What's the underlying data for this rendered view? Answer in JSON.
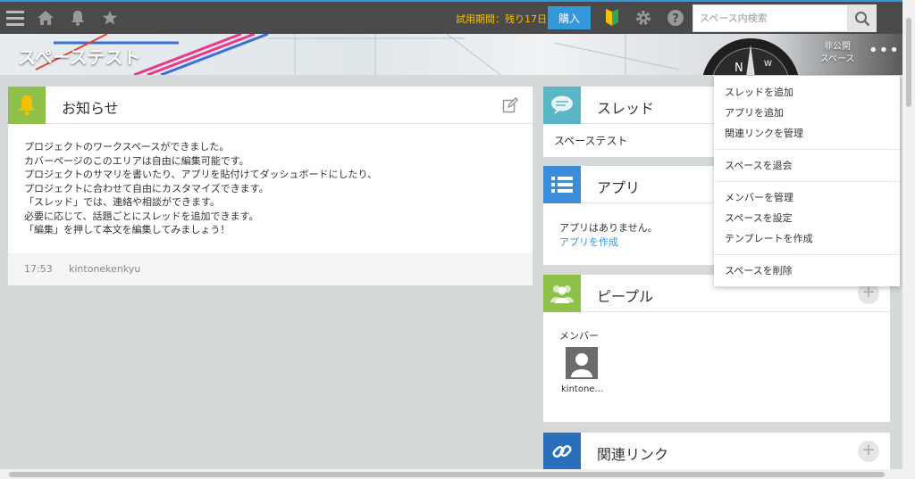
{
  "topbar": {
    "menu_icon": "hamburger-icon",
    "home_icon": "home-icon",
    "bell_icon": "bell-icon",
    "star_icon": "star-icon",
    "trial_text": "試用期間：残り17日",
    "buy_label": "購入",
    "beginner_icon": "beginner-mark-icon",
    "settings_icon": "gear-icon",
    "help_icon": "help-icon",
    "search_placeholder": "スペース内検索",
    "accent": "#3498db"
  },
  "cover": {
    "title": "スペーステスト",
    "public_line1": "非公開",
    "public_line2": "スペース",
    "more_label": "•••"
  },
  "notice": {
    "title": "お知らせ",
    "lines": [
      "プロジェクトのワークスペースができました。",
      "カバーページのこのエリアは自由に編集可能です。",
      "プロジェクトのサマリを書いたり、アプリを貼付けてダッシュボードにしたり、",
      "プロジェクトに合わせて自由にカスタマイズできます。",
      "「スレッド」では、連絡や相談ができます。",
      "必要に応じて、話題ごとにスレッドを追加できます。",
      "「編集」を押して本文を編集してみましょう！"
    ],
    "time": "17:53",
    "user": "kintonekenkyu"
  },
  "thread": {
    "title": "スレッド",
    "item": "スペーステスト"
  },
  "apps": {
    "title": "アプリ",
    "empty": "アプリはありません。",
    "create": "アプリを作成"
  },
  "people": {
    "title": "ピープル",
    "section": "メンバー",
    "member_name": "kintone…"
  },
  "links": {
    "title": "関連リンク"
  },
  "dropdown": {
    "items": [
      "スレッドを追加",
      "アプリを追加",
      "関連リンクを管理",
      "スペースを退会",
      "メンバーを管理",
      "スペースを設定",
      "テンプレートを作成",
      "スペースを削除"
    ]
  }
}
